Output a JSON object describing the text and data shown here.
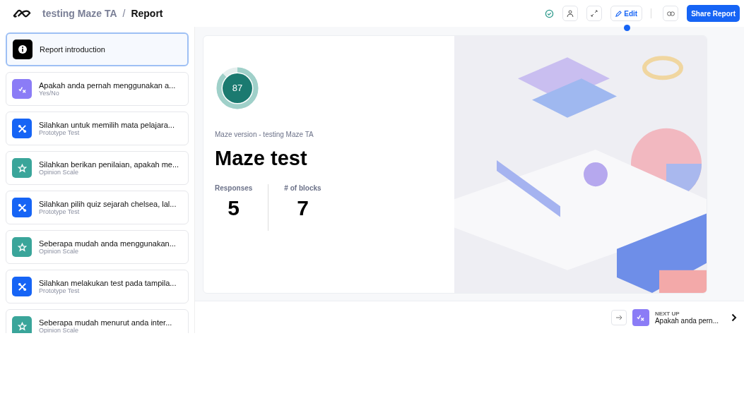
{
  "header": {
    "project": "testing Maze TA",
    "separator": "/",
    "page": "Report",
    "actions": {
      "edit": "Edit",
      "share": "Share Report"
    }
  },
  "sidebar": {
    "items": [
      {
        "kind": "intro",
        "title": "Report introduction",
        "selected": true
      },
      {
        "kind": "yesno",
        "title": "Apakah anda pernah menggunakan a...",
        "subtitle": "Yes/No",
        "selected": false
      },
      {
        "kind": "prototype",
        "title": "Silahkan untuk memilih mata pelajara...",
        "subtitle": "Prototype Test",
        "selected": false
      },
      {
        "kind": "opinion",
        "title": "Silahkan berikan penilaian, apakah me...",
        "subtitle": "Opinion Scale",
        "selected": false
      },
      {
        "kind": "prototype",
        "title": "Silahkan pilih quiz sejarah chelsea, lal...",
        "subtitle": "Prototype Test",
        "selected": false
      },
      {
        "kind": "opinion",
        "title": "Seberapa mudah anda menggunakan...",
        "subtitle": "Opinion Scale",
        "selected": false
      },
      {
        "kind": "prototype",
        "title": "Silahkan melakukan test pada tampila...",
        "subtitle": "Prototype Test",
        "selected": false
      },
      {
        "kind": "opinion",
        "title": "Seberapa mudah menurut anda inter...",
        "subtitle": "Opinion Scale",
        "selected": false
      }
    ]
  },
  "report": {
    "score": {
      "value": "87",
      "level": 0.87
    },
    "version": "Maze version - testing Maze TA",
    "title": "Maze test",
    "stats": [
      {
        "label": "Responses",
        "value": "5"
      },
      {
        "label": "# of blocks",
        "value": "7"
      }
    ]
  },
  "next_up": {
    "label": "NEXT UP",
    "kind": "yesno",
    "title": "Apakah anda pern..."
  }
}
